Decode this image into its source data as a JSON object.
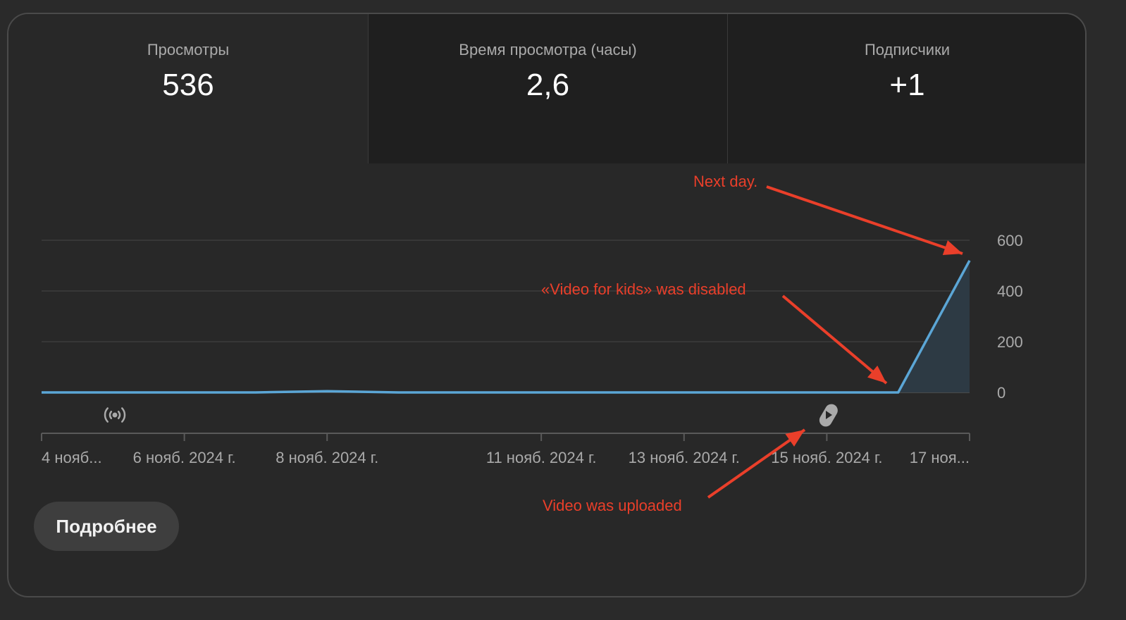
{
  "metrics": [
    {
      "label": "Просмотры",
      "value": "536"
    },
    {
      "label": "Время просмотра (часы)",
      "value": "2,6"
    },
    {
      "label": "Подписчики",
      "value": "+1"
    }
  ],
  "chart_data": {
    "type": "area",
    "x": [
      "4 нояб.",
      "5 нояб.",
      "6 нояб.",
      "7 нояб.",
      "8 нояб.",
      "9 нояб.",
      "10 нояб.",
      "11 нояб.",
      "12 нояб.",
      "13 нояб.",
      "14 нояб.",
      "15 нояб.",
      "16 нояб.",
      "17 нояб."
    ],
    "series": [
      {
        "values": [
          0,
          0,
          0,
          0,
          5,
          0,
          0,
          0,
          0,
          0,
          0,
          0,
          0,
          520
        ]
      }
    ],
    "ylim": [
      0,
      600
    ],
    "yticks": [
      "0",
      "200",
      "400",
      "600"
    ],
    "xticks": [
      {
        "index": 0,
        "label": "4 нояб..."
      },
      {
        "index": 2,
        "label": "6 нояб. 2024 г."
      },
      {
        "index": 4,
        "label": "8 нояб. 2024 г."
      },
      {
        "index": 7,
        "label": "11 нояб. 2024 г."
      },
      {
        "index": 9,
        "label": "13 нояб. 2024 г."
      },
      {
        "index": 11,
        "label": "15 нояб. 2024 г."
      },
      {
        "index": 13,
        "label": "17 ноя..."
      }
    ],
    "grid": true,
    "line_color": "#5ba6d6",
    "event_icons": [
      {
        "index": 1,
        "icon": "live-broadcast-icon"
      },
      {
        "index": 11,
        "icon": "shorts-icon"
      }
    ],
    "annotations": [
      {
        "text": "Next day.",
        "target_index": 13
      },
      {
        "text": "«Video for kids» was disabled",
        "target_index": 12
      },
      {
        "text": "Video was uploaded",
        "target_index": 11
      }
    ],
    "annotation_color": "#ea3f2a"
  },
  "buttons": {
    "more": "Подробнее"
  }
}
